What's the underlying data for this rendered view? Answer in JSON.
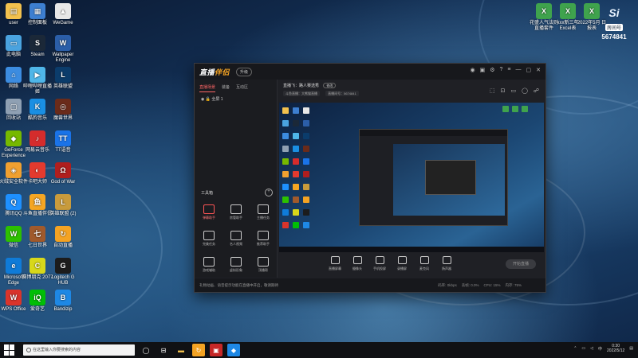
{
  "desktop": {
    "icons_left_col1": [
      {
        "label": "user",
        "color": "#f2c14e",
        "glyph": "▤"
      },
      {
        "label": "此电脑",
        "color": "#4aa3df",
        "glyph": "▭"
      },
      {
        "label": "网络",
        "color": "#3c8ce0",
        "glyph": "⌂"
      },
      {
        "label": "回收站",
        "color": "#8fa0b3",
        "glyph": "▢"
      },
      {
        "label": "GeForce Experience",
        "color": "#76b900",
        "glyph": "◆"
      },
      {
        "label": "火绒安全软件",
        "color": "#f0a030",
        "glyph": "◈"
      },
      {
        "label": "腾讯QQ",
        "color": "#1e90ff",
        "glyph": "Q"
      },
      {
        "label": "微信",
        "color": "#2dc100",
        "glyph": "W"
      },
      {
        "label": "Microsoft Edge",
        "color": "#0f7bd8",
        "glyph": "e"
      },
      {
        "label": "WPS Office",
        "color": "#d9342b",
        "glyph": "W"
      }
    ],
    "icons_left_col2": [
      {
        "label": "控制面板",
        "color": "#3d7fd1",
        "glyph": "▦"
      },
      {
        "label": "Steam",
        "color": "#1b2838",
        "glyph": "S"
      },
      {
        "label": "哔哩哔哩直播姬",
        "color": "#4fb6e8",
        "glyph": "▶"
      },
      {
        "label": "酷狗音乐",
        "color": "#1a8fe3",
        "glyph": "K"
      },
      {
        "label": "网易云音乐",
        "color": "#d52c2c",
        "glyph": "♪"
      },
      {
        "label": "卡吧大师",
        "color": "#e43a2e",
        "glyph": "◐"
      },
      {
        "label": "斗鱼直播伴侣",
        "color": "#f5a623",
        "glyph": "鱼"
      },
      {
        "label": "七日世界",
        "color": "#a05a2c",
        "glyph": "七"
      },
      {
        "label": "赛博朋克 2077",
        "color": "#d8d81a",
        "glyph": "C"
      },
      {
        "label": "爱奇艺",
        "color": "#00be06",
        "glyph": "iQ"
      }
    ],
    "icons_left_col3": [
      {
        "label": "WeGame",
        "color": "#e7e7e7",
        "glyph": "▲"
      },
      {
        "label": "Wallpaper Engine",
        "color": "#2b5ea8",
        "glyph": "W"
      },
      {
        "label": "英雄联盟",
        "color": "#0b3c6b",
        "glyph": "L"
      },
      {
        "label": "魔兽世界",
        "color": "#6a2b1a",
        "glyph": "◎"
      },
      {
        "label": "TT语音",
        "color": "#1a73e8",
        "glyph": "TT"
      },
      {
        "label": "God of War",
        "color": "#b01e1e",
        "glyph": "Ω"
      },
      {
        "label": "英雄联盟 (2)",
        "color": "#c89b3c",
        "glyph": "L"
      },
      {
        "label": "自动直播",
        "color": "#f4a323",
        "glyph": "↻"
      },
      {
        "label": "Logitech G HUB",
        "color": "#1c1c1c",
        "glyph": "G"
      },
      {
        "label": "Bandizip",
        "color": "#1e88e5",
        "glyph": "B"
      }
    ],
    "icons_top_right": [
      {
        "label": "花盛人气法则 直播套件",
        "color": "#3fa34d",
        "glyph": "X"
      },
      {
        "label": "xxx新三年 Excel表",
        "color": "#3fa34d",
        "glyph": "X"
      },
      {
        "label": "2022年5月 日报表",
        "color": "#3fa34d",
        "glyph": "X"
      }
    ],
    "badge": {
      "logo": "Si",
      "sub": "房间号",
      "number": "5674841"
    }
  },
  "app": {
    "name_a": "直播",
    "name_b": "伴侣",
    "upgrade": "升级",
    "sidebar": {
      "tabs": [
        "直播场景",
        "装备",
        "互动区"
      ],
      "scene_item": "全屏 1",
      "tools_title": "工具箱",
      "tools": [
        {
          "label": "弹幕助手",
          "red": true
        },
        {
          "label": "房管助手",
          "red": false
        },
        {
          "label": "主播任务",
          "red": false
        },
        {
          "label": "完美任务",
          "red": false
        },
        {
          "label": "名人视频",
          "red": false
        },
        {
          "label": "推荐助手",
          "red": false
        },
        {
          "label": "游戏辅助",
          "red": false
        },
        {
          "label": "虚拟形象",
          "red": false
        },
        {
          "label": "顶播帮",
          "red": false
        }
      ]
    },
    "preview": {
      "title": "直播飞：路人赛选秀",
      "tag": "修改",
      "info_a": "斗鱼直播：大熊猫直播",
      "info_b": "直播间号：5674841",
      "icons": [
        "⬚",
        "🔒",
        "⬜",
        "◯",
        "☍"
      ]
    },
    "bottom_tools": [
      "直播屏幕",
      "摄像头",
      "手机投屏",
      "录播屏",
      "麦克风",
      "扬声器"
    ],
    "start_live": "开始直播",
    "notice": "礼物动画、语音提示功能在直播中开启，敬请期待",
    "stats": [
      "码率: 0kbps",
      "丢帧: 0.0%",
      "CPU: 15%",
      "内存: 75%"
    ]
  },
  "taskbar": {
    "search_placeholder": "在这里输入你要搜索的内容",
    "time": "0:30",
    "date": "2022/5/12"
  }
}
